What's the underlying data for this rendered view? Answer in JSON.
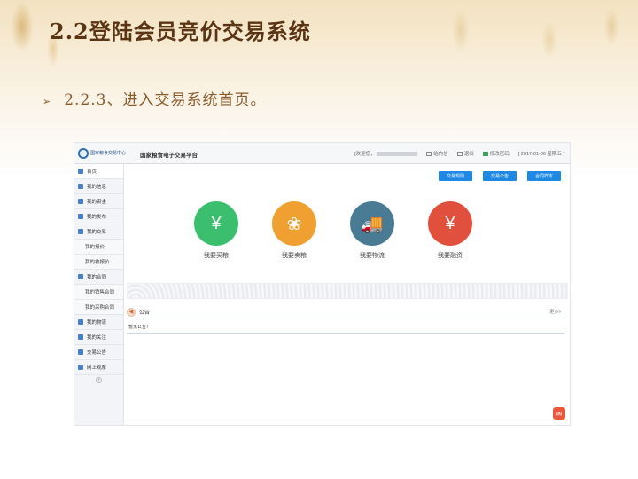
{
  "slide": {
    "title": "2.2登陆会员竞价交易系统",
    "subtitle": "2.2.3、进入交易系统首页。",
    "bullet": "➢"
  },
  "app": {
    "logo_text": "国家粮食交易中心",
    "platform_title": "国家粮食电子交易平台",
    "welcome": "[欢迎您，",
    "messages": "站内信",
    "logout": "退出",
    "password": "修改密码",
    "date": "[ 2017-01-06 星期五 ]"
  },
  "sidebar": {
    "items": [
      {
        "label": "首页",
        "icon": "home-icon"
      },
      {
        "label": "我的信息",
        "icon": "user-icon"
      },
      {
        "label": "我的资金",
        "icon": "money-icon"
      },
      {
        "label": "我的发布",
        "icon": "publish-icon"
      },
      {
        "label": "我的交易",
        "icon": "trade-icon"
      },
      {
        "label": "我的报价",
        "sub": true
      },
      {
        "label": "我的被报价",
        "sub": true
      },
      {
        "label": "我的合同",
        "icon": "contract-icon"
      },
      {
        "label": "我的销售合同",
        "sub": true
      },
      {
        "label": "我的采购合同",
        "sub": true
      },
      {
        "label": "我的物流",
        "icon": "logistics-icon"
      },
      {
        "label": "我的关注",
        "icon": "heart-icon"
      },
      {
        "label": "交易公告",
        "icon": "notice-icon"
      },
      {
        "label": "网上观摩",
        "icon": "view-icon"
      }
    ]
  },
  "main": {
    "buttons": [
      "交易规则",
      "交易公告",
      "合同样本"
    ],
    "tiles": [
      {
        "label": "我要买粮",
        "glyph": "¥",
        "color": "#3bbf6e"
      },
      {
        "label": "我要卖粮",
        "glyph": "❀",
        "color": "#f0a030"
      },
      {
        "label": "我要物流",
        "glyph": "🚚",
        "color": "#4a7b94"
      },
      {
        "label": "我要融资",
        "glyph": "¥",
        "color": "#e0503c"
      }
    ],
    "notice_title": "公告",
    "notice_more": "更多»",
    "notice_text": "暂无公告！"
  }
}
